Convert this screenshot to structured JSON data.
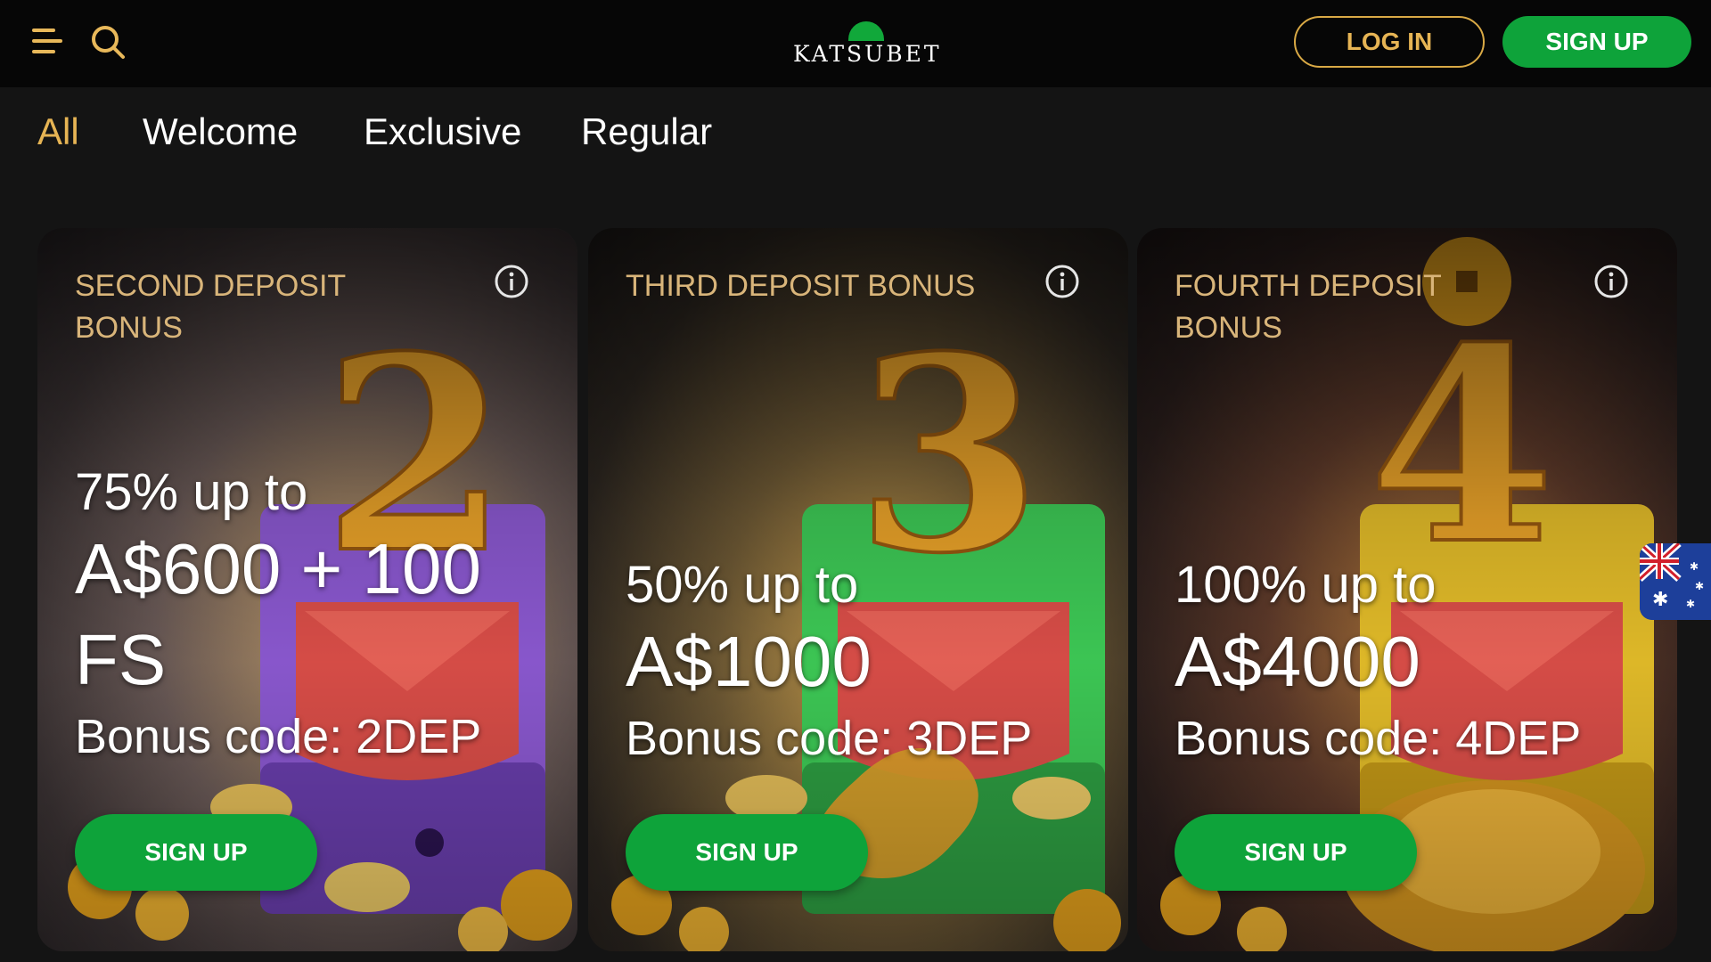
{
  "header": {
    "logo_text": "KATSUBET",
    "login_label": "LOG IN",
    "signup_label": "SIGN UP",
    "icons": [
      "menu-icon",
      "search-icon"
    ]
  },
  "tabs": [
    {
      "label": "All",
      "active": true
    },
    {
      "label": "Welcome",
      "active": false
    },
    {
      "label": "Exclusive",
      "active": false
    },
    {
      "label": "Regular",
      "active": false
    }
  ],
  "cards": [
    {
      "kicker": "SECOND DEPOSIT BONUS",
      "offer_line1": "75% up to",
      "offer_line2": "A$600 + 100",
      "offer_line3": "FS",
      "code": "Bonus code: 2DEP",
      "button": "SIGN UP",
      "glyph": "2",
      "chest_color": "#8f5bd6"
    },
    {
      "kicker": "THIRD DEPOSIT BONUS",
      "offer_line1": "50% up to",
      "offer_line2": "A$1000",
      "code": "Bonus code: 3DEP",
      "button": "SIGN UP",
      "glyph": "3",
      "chest_color": "#3fcf58"
    },
    {
      "kicker": "FOURTH DEPOSIT BONUS",
      "offer_line1": "100% up to",
      "offer_line2": "A$4000",
      "code": "Bonus code: 4DEP",
      "button": "SIGN UP",
      "glyph": "4",
      "chest_color": "#e9c12a"
    }
  ],
  "colors": {
    "accent_gold": "#e6b454",
    "brand_green": "#0ea33a",
    "header_bg": "#060606",
    "page_bg": "#141414"
  },
  "language_widget": {
    "icon": "australia-flag-icon"
  }
}
